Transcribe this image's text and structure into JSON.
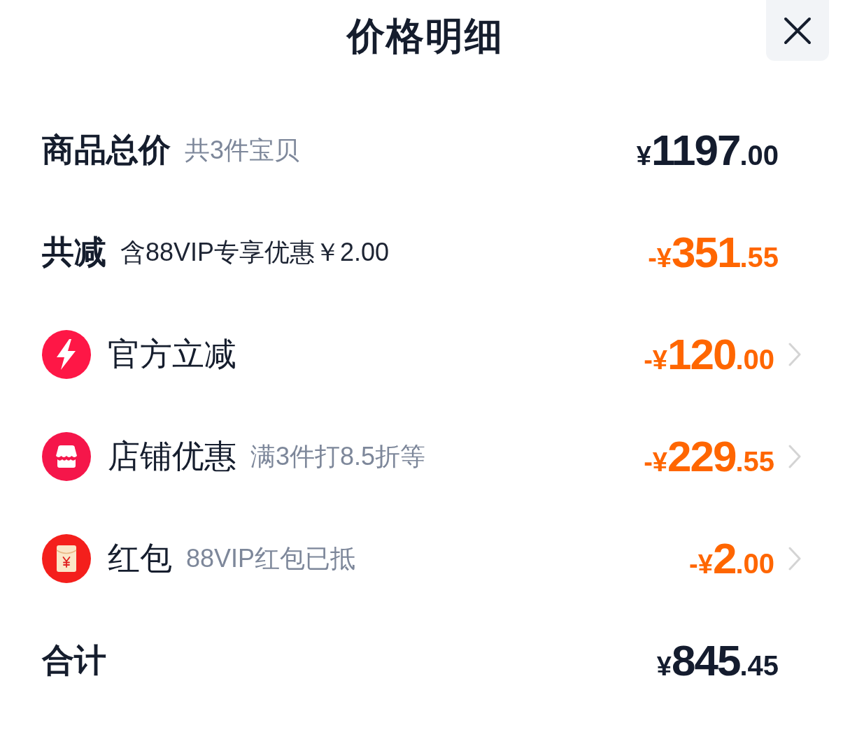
{
  "header": {
    "title": "价格明细"
  },
  "rows": [
    {
      "kind": "summary",
      "label": "商品总价",
      "note": "共3件宝贝",
      "note_muted": true,
      "amount": {
        "prefix": "¥",
        "integer": "1197",
        "decimal": ".00"
      },
      "link": false
    },
    {
      "kind": "reduction",
      "label": "共减",
      "note": "含88VIP专享优惠￥2.00",
      "note_muted": false,
      "amount": {
        "prefix": "-¥",
        "integer": "351",
        "decimal": ".55"
      },
      "link": false
    },
    {
      "kind": "platform",
      "label": "官方立减",
      "amount": {
        "prefix": "-¥",
        "integer": "120",
        "decimal": ".00"
      },
      "link": true
    },
    {
      "kind": "store",
      "label": "店铺优惠",
      "note": "满3件打8.5折等",
      "note_muted": true,
      "amount": {
        "prefix": "-¥",
        "integer": "229",
        "decimal": ".55"
      },
      "link": true
    },
    {
      "kind": "packet",
      "label": "红包",
      "note": "88VIP红包已抵",
      "note_muted": true,
      "amount": {
        "prefix": "-¥",
        "integer": "2",
        "decimal": ".00"
      },
      "link": true
    },
    {
      "kind": "summary",
      "label": "合计",
      "amount": {
        "prefix": "¥",
        "integer": "845",
        "decimal": ".45"
      },
      "link": false
    }
  ]
}
